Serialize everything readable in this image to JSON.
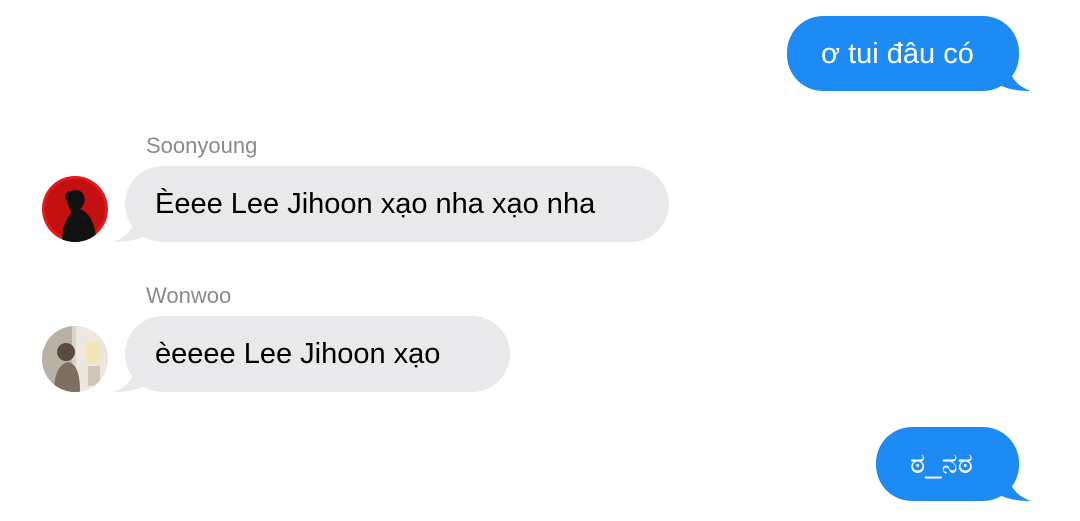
{
  "messages": [
    {
      "direction": "outgoing",
      "text": "ơ tui đâu có"
    },
    {
      "direction": "incoming",
      "sender": "Soonyoung",
      "text": "Èeee Lee Jihoon xạo nha xạo nha"
    },
    {
      "direction": "incoming",
      "sender": "Wonwoo",
      "text": "èeeee Lee Jihoon xạo"
    },
    {
      "direction": "outgoing",
      "text": "ಠ_ನಠ"
    }
  ],
  "colors": {
    "outgoing_bubble": "#1e8bf5",
    "incoming_bubble": "#e9e9eb",
    "sender_name": "#8a8a8e"
  }
}
